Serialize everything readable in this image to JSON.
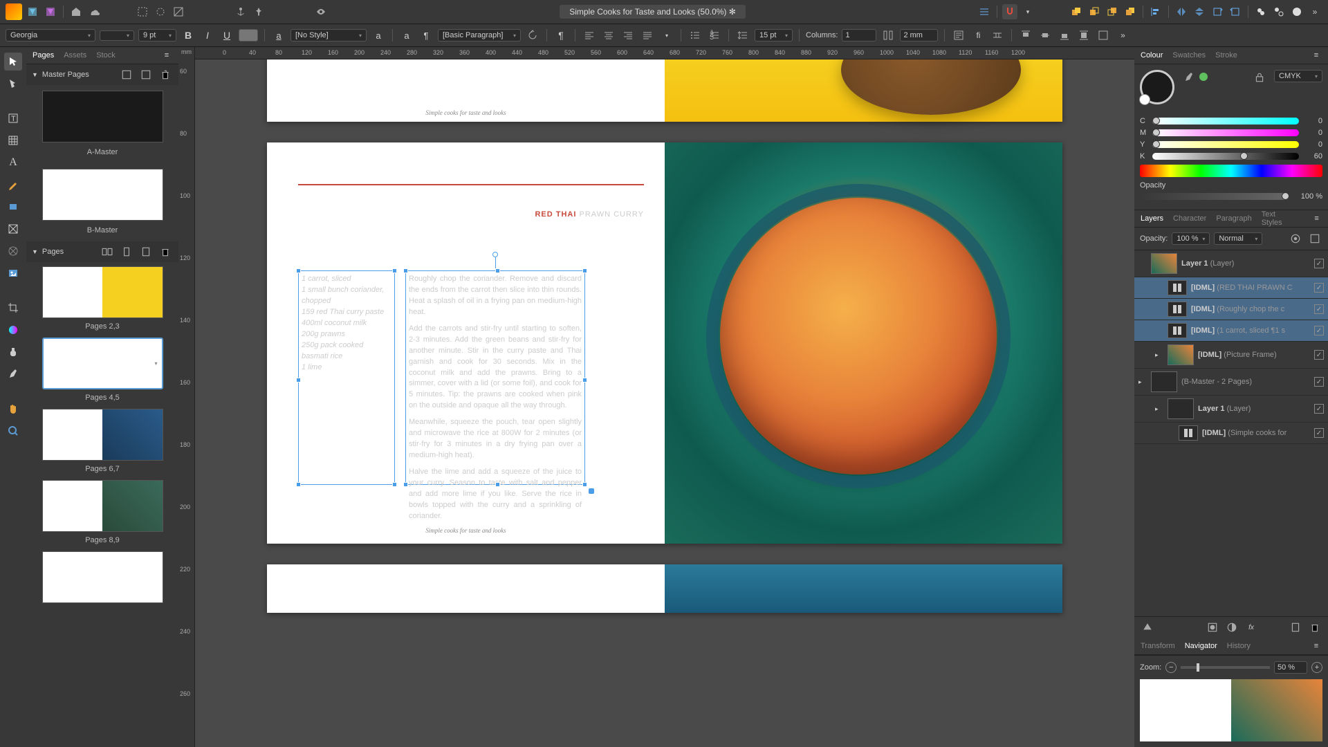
{
  "doc_title": "Simple Cooks for Taste and Looks (50.0%) ✻",
  "context": {
    "font": "Georgia",
    "size": "9 pt",
    "para_style": "[No Style]",
    "para_basic": "[Basic Paragraph]",
    "leading": "15 pt",
    "columns_label": "Columns:",
    "columns": "1",
    "gutter": "2 mm"
  },
  "left_tabs": [
    "Pages",
    "Assets",
    "Stock"
  ],
  "ruler_unit": "mm",
  "masters_label": "Master Pages",
  "masters": [
    "A-Master",
    "B-Master"
  ],
  "pages_label": "Pages",
  "page_sets": [
    "Pages 2,3",
    "Pages 4,5",
    "Pages 6,7",
    "Pages 8,9"
  ],
  "recipe": {
    "title_bold": "RED THAI",
    "title_rest": " PRAWN CURRY",
    "ingredients": [
      "1 carrot, sliced",
      "1 small bunch coriander, chopped",
      "159 red Thai curry paste",
      "400ml coconut milk",
      "200g prawns",
      "250g pack cooked basmati rice",
      "1 lime"
    ],
    "method": [
      "Roughly chop the coriander. Remove and discard the ends from the carrot then slice into thin rounds. Heat a splash of oil in a frying pan on medium-high heat.",
      "Add the carrots and stir-fry until starting to soften, 2-3 minutes. Add the green beans and stir-fry for another minute. Stir in the curry paste and Thai garnish and cook for 30 seconds. Mix in the coconut milk and add the prawns. Bring to a simmer, cover with a lid (or some foil), and cook for 5 minutes. Tip: the prawns are cooked when pink on the outside and opaque all the way through.",
      "Meanwhile, squeeze the pouch, tear open slightly and microwave the rice at 800W for 2 minutes (or stir-fry for 3 minutes in a dry frying pan over a medium-high heat).",
      "Halve the lime and add a squeeze of the juice to your curry. Season to taste with salt and pepper and add more lime if you like. Serve the rice in bowls topped with the curry and a sprinkling of coriander."
    ],
    "footer": "Simple cooks for taste and looks"
  },
  "colour": {
    "tab": "Colour",
    "tabs_other": [
      "Swatches",
      "Stroke"
    ],
    "model": "CMYK",
    "channels": [
      {
        "l": "C",
        "v": "0",
        "grad": "linear-gradient(90deg,#fff,#0ff)"
      },
      {
        "l": "M",
        "v": "0",
        "grad": "linear-gradient(90deg,#fff,#f0f)"
      },
      {
        "l": "Y",
        "v": "0",
        "grad": "linear-gradient(90deg,#fff,#ff0)"
      },
      {
        "l": "K",
        "v": "60",
        "grad": "linear-gradient(90deg,#fff,#000)"
      }
    ],
    "opacity_label": "Opacity",
    "opacity": "100 %"
  },
  "layers": {
    "tabs": [
      "Layers",
      "Character",
      "Paragraph",
      "Text Styles"
    ],
    "opacity_label": "Opacity:",
    "opacity": "100 %",
    "blend": "Normal",
    "items": [
      {
        "name": "Layer 1",
        "hint": "(Layer)",
        "sel": false,
        "thumb": "img"
      },
      {
        "name": "[IDML]",
        "hint": "(RED THAI PRAWN C",
        "sel": true,
        "thumb": "txt",
        "indent": 1
      },
      {
        "name": "[IDML]",
        "hint": "(Roughly chop the c",
        "sel": true,
        "thumb": "txt",
        "indent": 1
      },
      {
        "name": "[IDML]",
        "hint": "(1 carrot, sliced  ¶1 s",
        "sel": true,
        "thumb": "txt",
        "indent": 1
      },
      {
        "name": "[IDML]",
        "hint": "(Picture Frame)",
        "sel": false,
        "thumb": "img",
        "indent": 1,
        "arrow": true
      },
      {
        "name": "",
        "hint": "(B-Master - 2 Pages)",
        "sel": false,
        "thumb": "blank",
        "indent": 0,
        "arrow": true
      },
      {
        "name": "Layer 1",
        "hint": "(Layer)",
        "sel": false,
        "thumb": "blank",
        "indent": 1,
        "arrow": true
      },
      {
        "name": "[IDML]",
        "hint": "(Simple cooks for",
        "sel": false,
        "thumb": "txt",
        "indent": 2
      }
    ]
  },
  "nav": {
    "tabs": [
      "Transform",
      "Navigator",
      "History"
    ],
    "zoom_label": "Zoom:",
    "zoom": "50 %"
  },
  "ruler_marks_h": [
    0,
    40,
    80,
    120,
    160,
    200,
    240,
    280,
    320,
    360,
    400,
    440,
    480,
    520,
    560,
    600,
    640,
    680,
    720,
    760,
    800,
    840,
    880,
    920,
    960,
    1000,
    1040,
    1080,
    1120,
    1160,
    1200
  ],
  "ruler_marks_v": [
    60,
    80,
    100,
    120,
    140,
    160,
    180,
    200,
    220,
    240,
    260
  ]
}
